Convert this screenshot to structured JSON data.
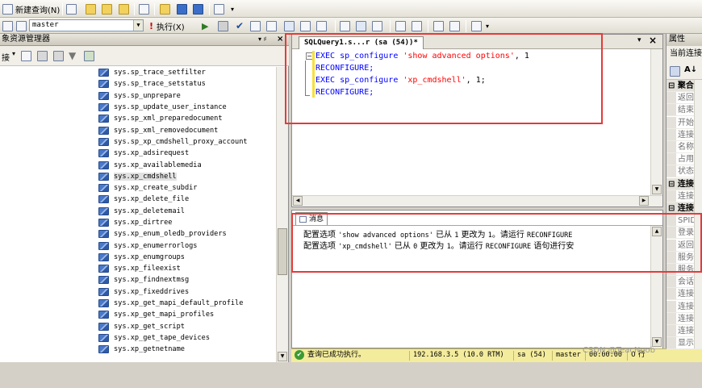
{
  "toolbar1": {
    "new_query": "新建查询(N)"
  },
  "toolbar2": {
    "database": "master",
    "execute": "执行(X)"
  },
  "object_explorer": {
    "title": "象资源管理器",
    "connect_label": "接"
  },
  "tree_items": [
    "sys.sp_trace_setfilter",
    "sys.sp_trace_setstatus",
    "sys.sp_unprepare",
    "sys.sp_update_user_instance",
    "sys.sp_xml_preparedocument",
    "sys.sp_xml_removedocument",
    "sys.sp_xp_cmdshell_proxy_account",
    "sys.xp_adsirequest",
    "sys.xp_availablemedia",
    "sys.xp_cmdshell",
    "sys.xp_create_subdir",
    "sys.xp_delete_file",
    "sys.xp_deletemail",
    "sys.xp_dirtree",
    "sys.xp_enum_oledb_providers",
    "sys.xp_enumerrorlogs",
    "sys.xp_enumgroups",
    "sys.xp_fileexist",
    "sys.xp_findnextmsg",
    "sys.xp_fixeddrives",
    "sys.xp_get_mapi_default_profile",
    "sys.xp_get_mapi_profiles",
    "sys.xp_get_script",
    "sys.xp_get_tape_devices",
    "sys.xp_getnetname"
  ],
  "selected_item": "sys.xp_cmdshell",
  "editor": {
    "tab_title": "SQLQuery1.s...r (sa (54))*",
    "lines": [
      {
        "kw1": "EXEC sp_configure ",
        "str": "'show advanced options'",
        "rest": ", 1"
      },
      {
        "kw1": "RECONFIGURE;",
        "str": "",
        "rest": ""
      },
      {
        "kw1": "EXEC sp_configure ",
        "str": "'xp_cmdshell'",
        "rest": ", 1;"
      },
      {
        "kw1": "RECONFIGURE;",
        "str": "",
        "rest": ""
      }
    ]
  },
  "messages": {
    "tab": "消息",
    "line1_a": "配置选项 ",
    "line1_b": "'show advanced options'",
    "line1_c": " 已从 ",
    "line1_d": "1",
    "line1_e": " 更改为 ",
    "line1_f": "1",
    "line1_g": "。请运行 ",
    "line1_h": "RECONFIGURE",
    "line2_a": "配置选项 ",
    "line2_b": "'xp_cmdshell'",
    "line2_c": " 已从 ",
    "line2_d": "0",
    "line2_e": " 更改为 ",
    "line2_f": "1",
    "line2_g": "。请运行 ",
    "line2_h": "RECONFIGURE",
    "line2_i": " 语句进行安"
  },
  "status": {
    "message": "查询已成功执行。",
    "server": "192.168.3.5 (10.0 RTM)",
    "user": "sa (54)",
    "db": "master",
    "time": "00:00:00",
    "rows": "0 行"
  },
  "properties": {
    "title": "属性",
    "current": "当前连接",
    "rows": [
      {
        "type": "cat",
        "text": "聚合状态"
      },
      {
        "type": "it",
        "text": "返回的行"
      },
      {
        "type": "it",
        "text": "结束时间"
      },
      {
        "type": "it",
        "text": "开始时间"
      },
      {
        "type": "it",
        "text": "连接失败"
      },
      {
        "type": "it",
        "text": "名称"
      },
      {
        "type": "it",
        "text": "占用时间"
      },
      {
        "type": "it",
        "text": "状态"
      },
      {
        "type": "cat",
        "text": "连接"
      },
      {
        "type": "it",
        "text": "连接名称"
      },
      {
        "type": "cat",
        "text": "连接详细"
      },
      {
        "type": "it",
        "text": "SPID"
      },
      {
        "type": "it",
        "text": "登录名"
      },
      {
        "type": "it",
        "text": "返回的行"
      },
      {
        "type": "it",
        "text": "服务器"
      },
      {
        "type": "it",
        "text": "服务器版本"
      },
      {
        "type": "it",
        "text": "会话跟踪"
      },
      {
        "type": "it",
        "text": "连接结束"
      },
      {
        "type": "it",
        "text": "连接开始"
      },
      {
        "type": "it",
        "text": "连接占用"
      },
      {
        "type": "it",
        "text": "连接状态"
      },
      {
        "type": "it",
        "text": "显示名称"
      }
    ]
  },
  "watermark": "CSDN @TeacNoob",
  "accent_red": "#e53a3a"
}
